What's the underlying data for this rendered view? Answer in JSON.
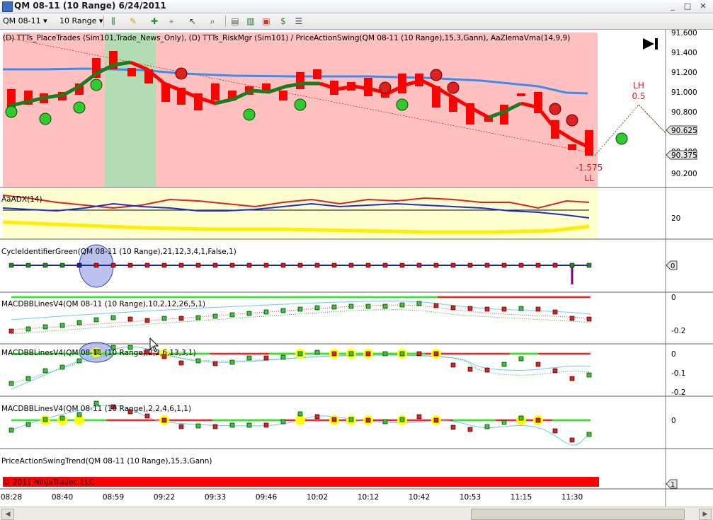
{
  "window": {
    "title": "QM 08-11 (10 Range)  6/24/2011",
    "min": "_",
    "max": "□",
    "close": "✕"
  },
  "toolbar": {
    "instrument": "QM 08-11",
    "interval": "10 Range",
    "icons": [
      "bars-icon",
      "pencil-icon",
      "plus-icon",
      "pin-icon",
      "cursor-icon",
      "magnifier-icon",
      "strategy-icon",
      "indicator-icon",
      "dollar-icon",
      "properties-icon"
    ]
  },
  "panels": {
    "price": {
      "label": "(D) TTTs_PlaceTrades (Sim101,Trade_News_Only), (D) TTTs_RiskMgr (Sim101) / PriceActionSwing(QM 08-11 (10 Range),15,3,Gann), AaZlemaVma(14,9,9)",
      "lh_label": "LH",
      "lh_value": "0.5",
      "ll_value": "-1.575",
      "ll_label": "LL",
      "price_tag_1": "90.625",
      "price_tag_2": "90.375",
      "axis_ticks": [
        "91.600",
        "91.400",
        "91.200",
        "91.000",
        "90.800",
        "90.600",
        "90.400",
        "90.200"
      ]
    },
    "adx": {
      "label": "AaADX(14)",
      "tick": "20"
    },
    "cycle": {
      "label": "CycleIdentifierGreen(QM 08-11 (10 Range),21,12,3,4,1,False,1)",
      "tag": "0"
    },
    "macd1": {
      "label": "MACDBBLinesV4(QM 08-11 (10 Range),10,2,12,26,5,1)",
      "ticks": [
        "0",
        "-0.2"
      ]
    },
    "macd2": {
      "label": "MACDBBLinesV4(QM 08-11 (10 Range),2,2,6,13,3,1)",
      "ticks": [
        "0",
        "-0.1",
        "-0.2"
      ]
    },
    "macd3": {
      "label": "MACDBBLinesV4(QM 08-11 (10 Range),2,2,4,6,1,1)",
      "ticks": [
        "0"
      ]
    },
    "trend": {
      "label": "PriceActionSwingTrend(QM 08-11 (10 Range),15,3,Gann)",
      "tag": "1"
    }
  },
  "copyright": "© 2011 NinjaTrader, LLC",
  "time_axis": [
    "08:28",
    "08:40",
    "08:59",
    "09:22",
    "09:33",
    "09:46",
    "10:02",
    "10:12",
    "10:42",
    "10:53",
    "11:15",
    "11:30"
  ],
  "colors": {
    "price_bg": "#ffc0c0",
    "highlight_band": "#b4dcb4",
    "adx_bg": "#ffffd0",
    "up_candle": "#ff0000",
    "swing_green": "#1e7a1e",
    "ema_blue": "#3c8cf0",
    "trend_bar": "#ff0000"
  }
}
